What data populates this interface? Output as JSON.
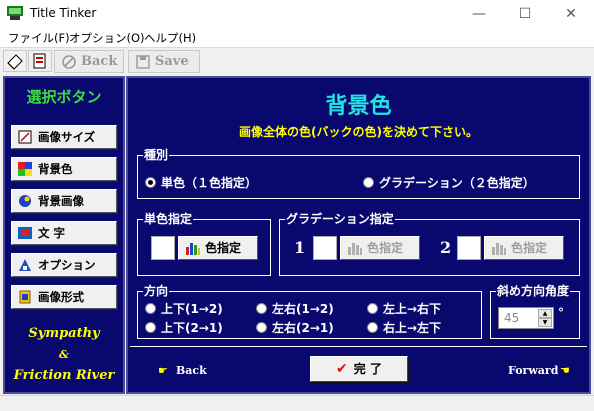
{
  "window": {
    "title": "Title Tinker",
    "minimize": "—",
    "maximize": "☐",
    "close": "✕"
  },
  "menu": [
    "ファイル(F)",
    "オプション(O)",
    "ヘルプ(H)"
  ],
  "toolbar": {
    "back_label": "Back",
    "save_label": "Save"
  },
  "sidebar": {
    "title": "選択ボタン",
    "items": [
      {
        "label": "画像サイズ",
        "icon": "image-size-icon"
      },
      {
        "label": "背景色",
        "icon": "color-palette-icon"
      },
      {
        "label": "背景画像",
        "icon": "background-image-icon"
      },
      {
        "label": "文 字",
        "icon": "text-icon"
      },
      {
        "label": "オプション",
        "icon": "options-icon"
      },
      {
        "label": "画像形式",
        "icon": "image-format-icon"
      }
    ],
    "credit": {
      "line1": "Sympathy",
      "amp": "&",
      "line2": "Friction River"
    }
  },
  "main": {
    "title": "背景色",
    "subtitle": "画像全体の色(バックの色)を決めて下さい。",
    "type_group": {
      "label": "種別",
      "options": [
        {
          "label": "単色（１色指定）",
          "selected": true
        },
        {
          "label": "グラデーション（２色指定）",
          "selected": false
        }
      ]
    },
    "single": {
      "label": "単色指定",
      "button": "色指定"
    },
    "gradient": {
      "label": "グラデーション指定",
      "num1": "1",
      "num2": "2",
      "button1": "色指定",
      "button2": "色指定"
    },
    "direction": {
      "label": "方向",
      "options": [
        "上下(1→2)",
        "左右(1→2)",
        "左上→右下",
        "上下(2→1)",
        "左右(2→1)",
        "右上→左下"
      ]
    },
    "angle": {
      "label": "斜め方向角度",
      "value": "45",
      "unit": "°"
    },
    "nav": {
      "back": "Back",
      "forward": "Forward",
      "done": "完 了"
    }
  },
  "colors": {
    "panel": "#08086e",
    "title": "#21e3e3",
    "subtitle": "#ffff00",
    "sidebar_title": "#3cde3c"
  }
}
